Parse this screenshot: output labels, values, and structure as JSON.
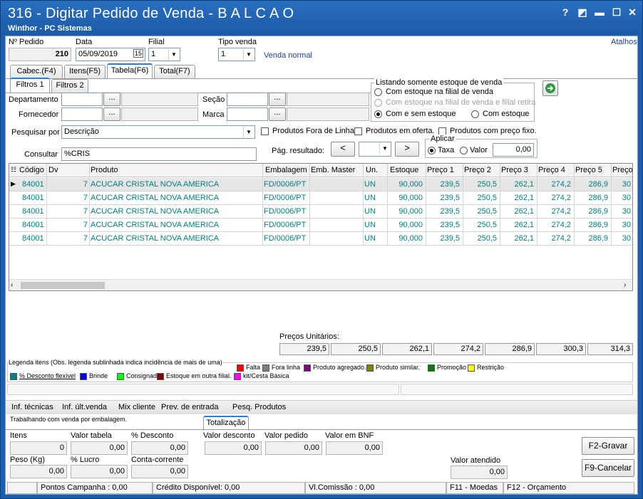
{
  "window": {
    "title": "316 - Digitar Pedido de Venda - B A L C A O",
    "subtitle": "Winthor - PC Sistemas",
    "help": "?",
    "restore": "◩",
    "minimize": "▬",
    "maximize": "☐",
    "close": "✕"
  },
  "header": {
    "pedido_label": "Nº Pedido",
    "pedido_value": "210",
    "data_label": "Data",
    "data_value": "05/09/2019",
    "calendar_icon": "15",
    "filial_label": "Filial",
    "filial_value": "1",
    "tipo_venda_label": "Tipo venda",
    "tipo_venda_value": "1",
    "tipo_venda_desc": "Venda normal",
    "atalhos": "Atalhos"
  },
  "main_tabs": [
    {
      "label": "Cabec.(F4)"
    },
    {
      "label": "Itens(F5)"
    },
    {
      "label": "Tabela(F6)"
    },
    {
      "label": "Total(F7)"
    }
  ],
  "filter_tabs": [
    {
      "label": "Filtros 1"
    },
    {
      "label": "Filtros 2"
    }
  ],
  "filters": {
    "departamento_label": "Departamento",
    "fornecedor_label": "Fornecedor",
    "secao_label": "Seção",
    "marca_label": "Marca",
    "dots": "...",
    "pesquisar_label": "Pesquisar por",
    "pesquisar_value": "Descrição",
    "consultar_label": "Consultar",
    "consultar_value": "%CRIS",
    "fora_linha": "Produtos Fora de Linha",
    "em_oferta": "Produtos em oferta.",
    "preco_fixo": "Produtos com preço fixo.",
    "pag_resultado": "Pág. resultado:",
    "prev": "<",
    "next": ">"
  },
  "estoque_group": {
    "title": "Listando somente estoque de venda",
    "opt1": "Com estoque na filial de venda",
    "opt2": "Com estoque na filial de venda e filial retira",
    "opt3": "Com e sem estoque",
    "opt4": "Com estoque"
  },
  "aplicar_group": {
    "title": "Aplicar",
    "taxa": "Taxa",
    "valor": "Valor",
    "value": "0,00"
  },
  "grid": {
    "columns": [
      "Código",
      "Dv",
      "Produto",
      "Embalagem",
      "Emb. Master",
      "Un.",
      "Estoque",
      "Preço 1",
      "Preço 2",
      "Preço 3",
      "Preço 4",
      "Preço 5",
      "Preço"
    ],
    "rows": [
      [
        "84001",
        "7",
        "ACUCAR CRISTAL NOVA AMERICA",
        "FD/0006/PT",
        "",
        "UN",
        "90,000",
        "239,5",
        "250,5",
        "262,1",
        "274,2",
        "286,9",
        "30"
      ],
      [
        "84001",
        "7",
        "ACUCAR CRISTAL NOVA AMERICA",
        "FD/0006/PT",
        "",
        "UN",
        "90,000",
        "239,5",
        "250,5",
        "262,1",
        "274,2",
        "286,9",
        "30"
      ],
      [
        "84001",
        "7",
        "ACUCAR CRISTAL NOVA AMERICA",
        "FD/0006/PT",
        "",
        "UN",
        "90,000",
        "239,5",
        "250,5",
        "262,1",
        "274,2",
        "286,9",
        "30"
      ],
      [
        "84001",
        "7",
        "ACUCAR CRISTAL NOVA AMERICA",
        "FD/0006/PT",
        "",
        "UN",
        "90,000",
        "239,5",
        "250,5",
        "262,1",
        "274,2",
        "286,9",
        "30"
      ],
      [
        "84001",
        "7",
        "ACUCAR CRISTAL NOVA AMERICA",
        "FD/0006/PT",
        "",
        "UN",
        "90,000",
        "239,5",
        "250,5",
        "262,1",
        "274,2",
        "286,9",
        "30"
      ]
    ]
  },
  "precos_unitarios": {
    "label": "Preços Unitários:",
    "values": [
      "239,5",
      "250,5",
      "262,1",
      "274,2",
      "286,9",
      "300,3",
      "314,3"
    ]
  },
  "legenda": {
    "title": "Legenda itens (Obs. legenda sublinhada indica incidência de mais de uma)",
    "items": [
      {
        "label": "Falta",
        "color": "#ff0000"
      },
      {
        "label": "Fora linha",
        "color": "#808080"
      },
      {
        "label": "Produto agregado.",
        "color": "#800080"
      },
      {
        "label": "Produto similar.",
        "color": "#808000"
      },
      {
        "label": "Promoção",
        "color": "#008000"
      },
      {
        "label": "Restrição",
        "color": "#ffff00"
      },
      {
        "label": "% Desconto flexível",
        "color": "#008080"
      },
      {
        "label": "Brinde",
        "color": "#0000ff"
      },
      {
        "label": "Consignado",
        "color": "#00ff00"
      },
      {
        "label": "Estoque em outra filial.",
        "color": "#800000"
      },
      {
        "label": "kit/Cesta Básica",
        "color": "#ff00ff"
      }
    ]
  },
  "bottom_links": [
    "Inf. técnicas",
    "Inf. últ.venda",
    "Mix cliente",
    "Prev. de entrada",
    "Pesq. Produtos"
  ],
  "embalagem_msg": "Trabalhando com venda por embalagem.",
  "totalizacao_tab": "Totalização",
  "totals": {
    "itens_label": "Itens",
    "itens_value": "0",
    "valor_tabela_label": "Valor tabela",
    "valor_tabela_value": "0,00",
    "desconto_label": "% Desconto",
    "desconto_value": "0,00",
    "peso_label": "Peso (Kg)",
    "peso_value": "0,00",
    "lucro_label": "% Lucro",
    "lucro_value": "0,00",
    "cc_label": "Conta-corrente",
    "cc_value": "0,00",
    "valor_desconto_label": "Valor desconto",
    "valor_desconto_value": "0,00",
    "valor_pedido_label": "Valor pedido",
    "valor_pedido_value": "0,00",
    "valor_bnf_label": "Valor em BNF",
    "valor_bnf_value": "0,00",
    "valor_atendido_label": "Valor atendido",
    "valor_atendido_value": "0,00"
  },
  "actions": {
    "gravar": "F2-Gravar",
    "cancelar": "F9-Cancelar"
  },
  "status": {
    "campanha": "Pontos Campanha : 0,00",
    "credito": "Crédito Disponível: 0,00",
    "comissao": "Vl.Comissão : 0,00",
    "f11": "F11 - Moedas",
    "f12": "F12 - Orçamento"
  }
}
